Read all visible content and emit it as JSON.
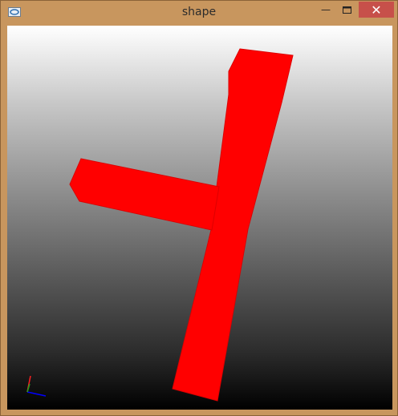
{
  "window": {
    "title": "shape",
    "app_icon": "app-window-icon",
    "controls": {
      "minimize": "minimize-icon",
      "maximize": "maximize-icon",
      "close": "close-icon"
    }
  },
  "viewport": {
    "shape_color": "#ff0000",
    "axis_colors": {
      "x": "#0000ff",
      "y": "#ff0000",
      "z": "#00a000"
    }
  }
}
